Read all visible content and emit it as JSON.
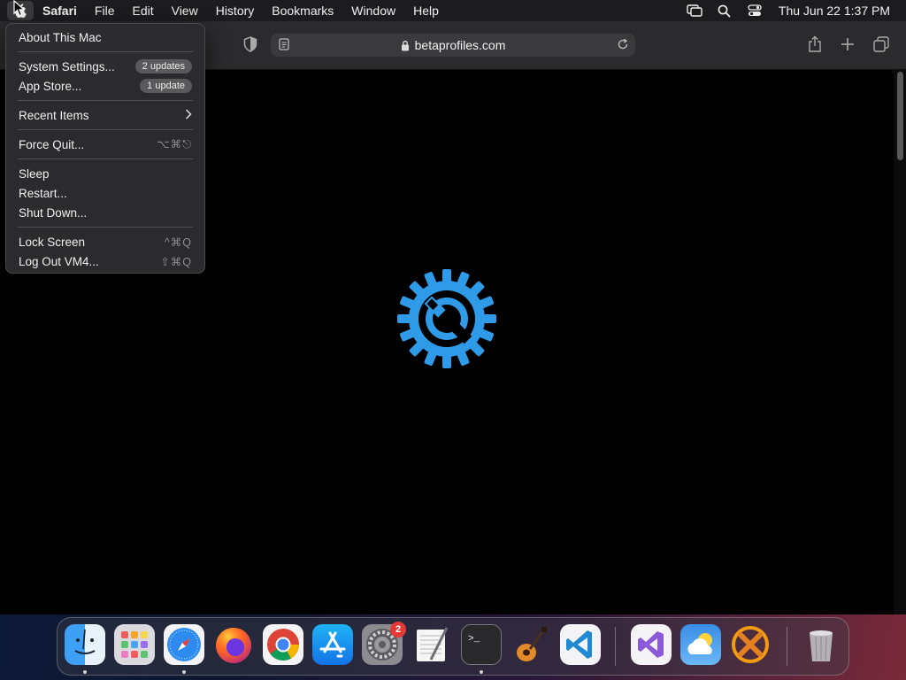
{
  "menubar": {
    "app_name": "Safari",
    "menus": [
      "File",
      "Edit",
      "View",
      "History",
      "Bookmarks",
      "Window",
      "Help"
    ],
    "clock": "Thu Jun 22  1:37 PM"
  },
  "safari": {
    "url": "betaprofiles.com"
  },
  "apple_menu": {
    "about": "About This Mac",
    "system_settings": "System Settings...",
    "system_settings_badge": "2 updates",
    "app_store": "App Store...",
    "app_store_badge": "1 update",
    "recent_items": "Recent Items",
    "force_quit": "Force Quit...",
    "force_quit_shortcut": "⌥⌘⎋",
    "sleep": "Sleep",
    "restart": "Restart...",
    "shut_down": "Shut Down...",
    "lock_screen": "Lock Screen",
    "lock_screen_shortcut": "^⌘Q",
    "log_out": "Log Out VM4...",
    "log_out_shortcut": "⇧⌘Q"
  },
  "dock": {
    "system_settings_badge": "2"
  },
  "colors": {
    "gear": "#2f9be8",
    "menubar": "#1c1c1e",
    "toolbar": "#2b2b2d"
  }
}
